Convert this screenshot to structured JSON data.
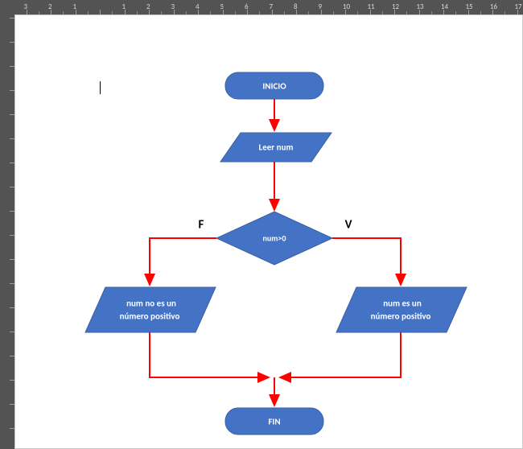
{
  "ruler": {
    "h_labels": [
      "3",
      "2",
      "1",
      "",
      "1",
      "2",
      "3",
      "4",
      "5",
      "6",
      "7",
      "8",
      "9",
      "10",
      "11",
      "12",
      "13",
      "14",
      "15",
      "16",
      "17"
    ],
    "v_labels_top": [
      "",
      ""
    ]
  },
  "flowchart": {
    "start": "INICIO",
    "read": "Leer num",
    "condition": "num>0",
    "false_label": "F",
    "true_label": "V",
    "result_false_line1": "num no es un",
    "result_false_line2": "número positivo",
    "result_true_line1": "num es un",
    "result_true_line2": "número positivo",
    "end": "FIN"
  },
  "colors": {
    "shape_fill": "#4472C4",
    "shape_border": "#3a5fa6",
    "shape_text": "#FFFFFF",
    "arrow": "#FF0000",
    "page": "#FFFFFF",
    "app_bg": "#535353"
  }
}
